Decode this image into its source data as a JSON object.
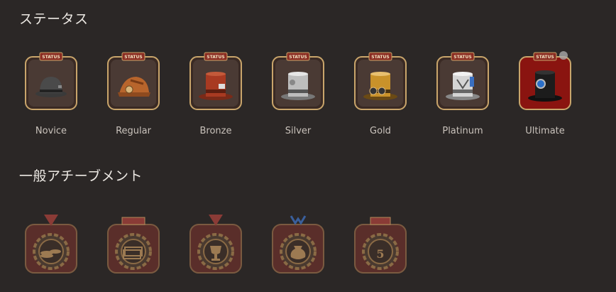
{
  "sections": {
    "status_title": "ステータス",
    "achievements_title": "一般アチーブメント"
  },
  "statuses": [
    {
      "label": "Novice",
      "badge_text": "STATUS",
      "hat": "bowler-hat"
    },
    {
      "label": "Regular",
      "badge_text": "STATUS",
      "hat": "deerstalker-hat"
    },
    {
      "label": "Bronze",
      "badge_text": "STATUS",
      "hat": "bronze-top-hat"
    },
    {
      "label": "Silver",
      "badge_text": "STATUS",
      "hat": "silver-top-hat"
    },
    {
      "label": "Gold",
      "badge_text": "STATUS",
      "hat": "gold-top-hat"
    },
    {
      "label": "Platinum",
      "badge_text": "STATUS",
      "hat": "platinum-top-hat"
    },
    {
      "label": "Ultimate",
      "badge_text": "STATUS",
      "hat": "ultimate-top-hat"
    }
  ],
  "achievements": [
    {
      "icon": "coins-icon",
      "locked": true
    },
    {
      "icon": "banknotes-icon",
      "locked": true
    },
    {
      "icon": "trophy-icon",
      "locked": true
    },
    {
      "icon": "money-bag-icon",
      "locked": true
    },
    {
      "icon": "number-five-coin-icon",
      "locked": true,
      "label_text": "5"
    }
  ],
  "colors": {
    "background": "#2b2726",
    "frame_gold": "#c9a56b",
    "badge_red": "#8a2c22",
    "locked_tint": "#6b3a36"
  }
}
